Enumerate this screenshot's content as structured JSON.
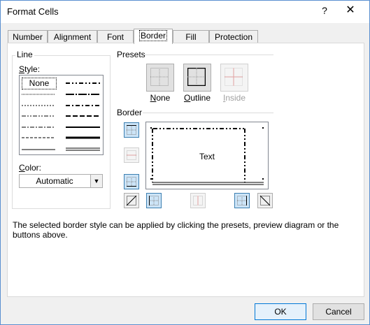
{
  "window": {
    "title": "Format Cells",
    "help": "?",
    "close": "✕"
  },
  "tabs": [
    {
      "label": "Number"
    },
    {
      "label": "Alignment"
    },
    {
      "label": "Font"
    },
    {
      "label": "Border"
    },
    {
      "label": "Fill"
    },
    {
      "label": "Protection"
    }
  ],
  "line": {
    "group_label": "Line",
    "style_label": "Style:",
    "style_none": "None",
    "color_label": "Color:",
    "color_value": "Automatic"
  },
  "presets": {
    "group_label": "Presets",
    "items": [
      {
        "label": "None"
      },
      {
        "label": "Outline"
      },
      {
        "label": "Inside"
      }
    ]
  },
  "border": {
    "group_label": "Border",
    "preview_text": "Text"
  },
  "description": "The selected border style can be applied by clicking the presets, preview diagram or the buttons above.",
  "buttons": {
    "ok": "OK",
    "cancel": "Cancel"
  },
  "colors": {
    "accent": "#0078d7",
    "selected_button": "#cce4f7",
    "frame": "#5a8fd0"
  }
}
